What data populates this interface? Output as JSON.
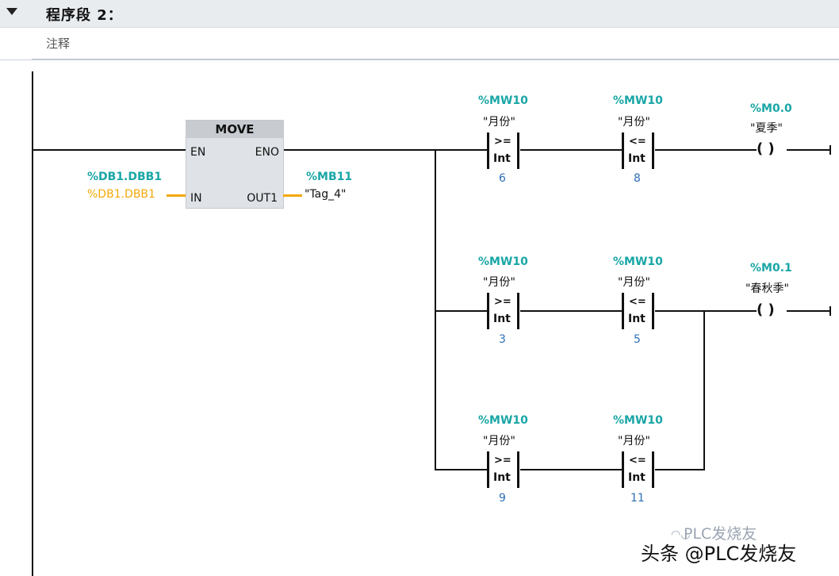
{
  "network": {
    "title": "程序段 2：",
    "comment": "注释"
  },
  "move_box": {
    "title": "MOVE",
    "pins": {
      "en": "EN",
      "eno": "ENO",
      "in": "IN",
      "out": "OUT1"
    },
    "in_addr": "%DB1.DBB1",
    "in_value": "%DB1.DBB1",
    "out_addr": "%MB11",
    "out_tag": "\"Tag_4\""
  },
  "rows": [
    {
      "contacts": [
        {
          "addr": "%MW10",
          "tag": "\"月份\"",
          "op": ">=",
          "type": "Int",
          "value": "6"
        },
        {
          "addr": "%MW10",
          "tag": "\"月份\"",
          "op": "<=",
          "type": "Int",
          "value": "8"
        }
      ],
      "coil": {
        "addr": "%M0.0",
        "tag": "\"夏季\"",
        "symbol": "( )"
      }
    },
    {
      "contacts": [
        {
          "addr": "%MW10",
          "tag": "\"月份\"",
          "op": ">=",
          "type": "Int",
          "value": "3"
        },
        {
          "addr": "%MW10",
          "tag": "\"月份\"",
          "op": "<=",
          "type": "Int",
          "value": "5"
        }
      ],
      "coil": {
        "addr": "%M0.1",
        "tag": "\"春秋季\"",
        "symbol": "( )"
      }
    },
    {
      "contacts": [
        {
          "addr": "%MW10",
          "tag": "\"月份\"",
          "op": ">=",
          "type": "Int",
          "value": "9"
        },
        {
          "addr": "%MW10",
          "tag": "\"月份\"",
          "op": "<=",
          "type": "Int",
          "value": "11"
        }
      ]
    }
  ],
  "watermark": {
    "top": "PLC发烧友",
    "main": "头条 @PLC发烧友"
  },
  "colors": {
    "address": "#1aa6a6",
    "value": "#2f6fb5",
    "highlight_wire": "#f2a90a",
    "header_bg": "#e9ecef"
  }
}
